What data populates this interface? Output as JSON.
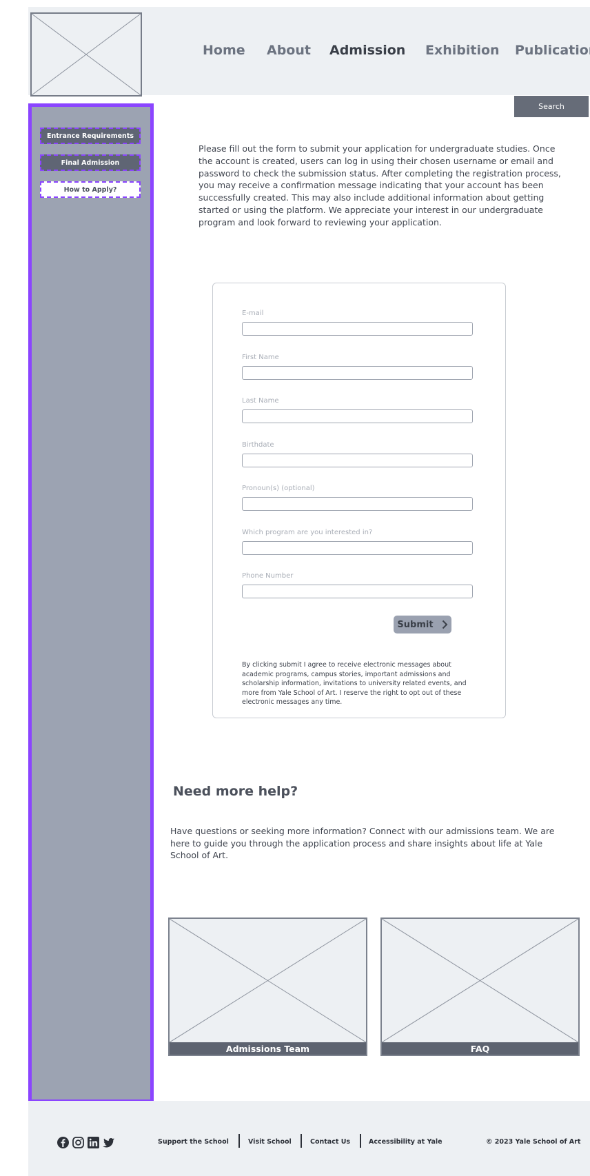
{
  "nav": {
    "items": [
      "Home",
      "About",
      "Admission",
      "Exhibition",
      "Publication"
    ],
    "active": "Admission"
  },
  "search": {
    "label": "Search"
  },
  "sidebar": {
    "items": [
      "Entrance Requirements",
      "Final Admission",
      "How to Apply?"
    ]
  },
  "intro": {
    "text": "Please fill out the form to submit your application for undergraduate studies. Once the account is created, users can log in using their chosen username or email and password to check the submission status. After completing the registration process, you may receive a confirmation message indicating that your account has been successfully created. This may also include additional information about getting started or using the platform. We appreciate your interest in our undergraduate program and look forward to reviewing your application."
  },
  "form": {
    "fields": [
      {
        "label": "E-mail",
        "value": ""
      },
      {
        "label": "First Name",
        "value": ""
      },
      {
        "label": "Last Name",
        "value": ""
      },
      {
        "label": "Birthdate",
        "value": ""
      },
      {
        "label": "Pronoun(s) (optional)",
        "value": ""
      },
      {
        "label": "Which program are you interested in?",
        "value": ""
      },
      {
        "label": "Phone Number",
        "value": ""
      }
    ],
    "submit_label": "Submit",
    "consent": "By clicking submit I agree to receive electronic messages about academic programs, campus stories, important admissions and scholarship information, invitations to university related events, and more from Yale School of Art. I reserve the right to opt out of these electronic messages any time."
  },
  "help": {
    "title": "Need more help?",
    "text": "Have questions or seeking more information? Connect with our admissions team. We are here to guide you through the application process and share insights about life at Yale School of Art."
  },
  "cards": [
    {
      "label": "Admissions Team"
    },
    {
      "label": "FAQ"
    }
  ],
  "footer": {
    "social_icons": [
      "facebook-icon",
      "instagram-icon",
      "linkedin-icon",
      "twitter-icon"
    ],
    "links": [
      "Support the School",
      "Visit School",
      "Contact Us",
      "Accessibility at Yale"
    ],
    "copyright": "© 2023 Yale School of Art"
  },
  "colors": {
    "sidebar_bg": "#9ca3b2",
    "sidebar_border": "#8b45ff",
    "header_bg": "#edf0f3",
    "button_dark": "#5f6574"
  }
}
